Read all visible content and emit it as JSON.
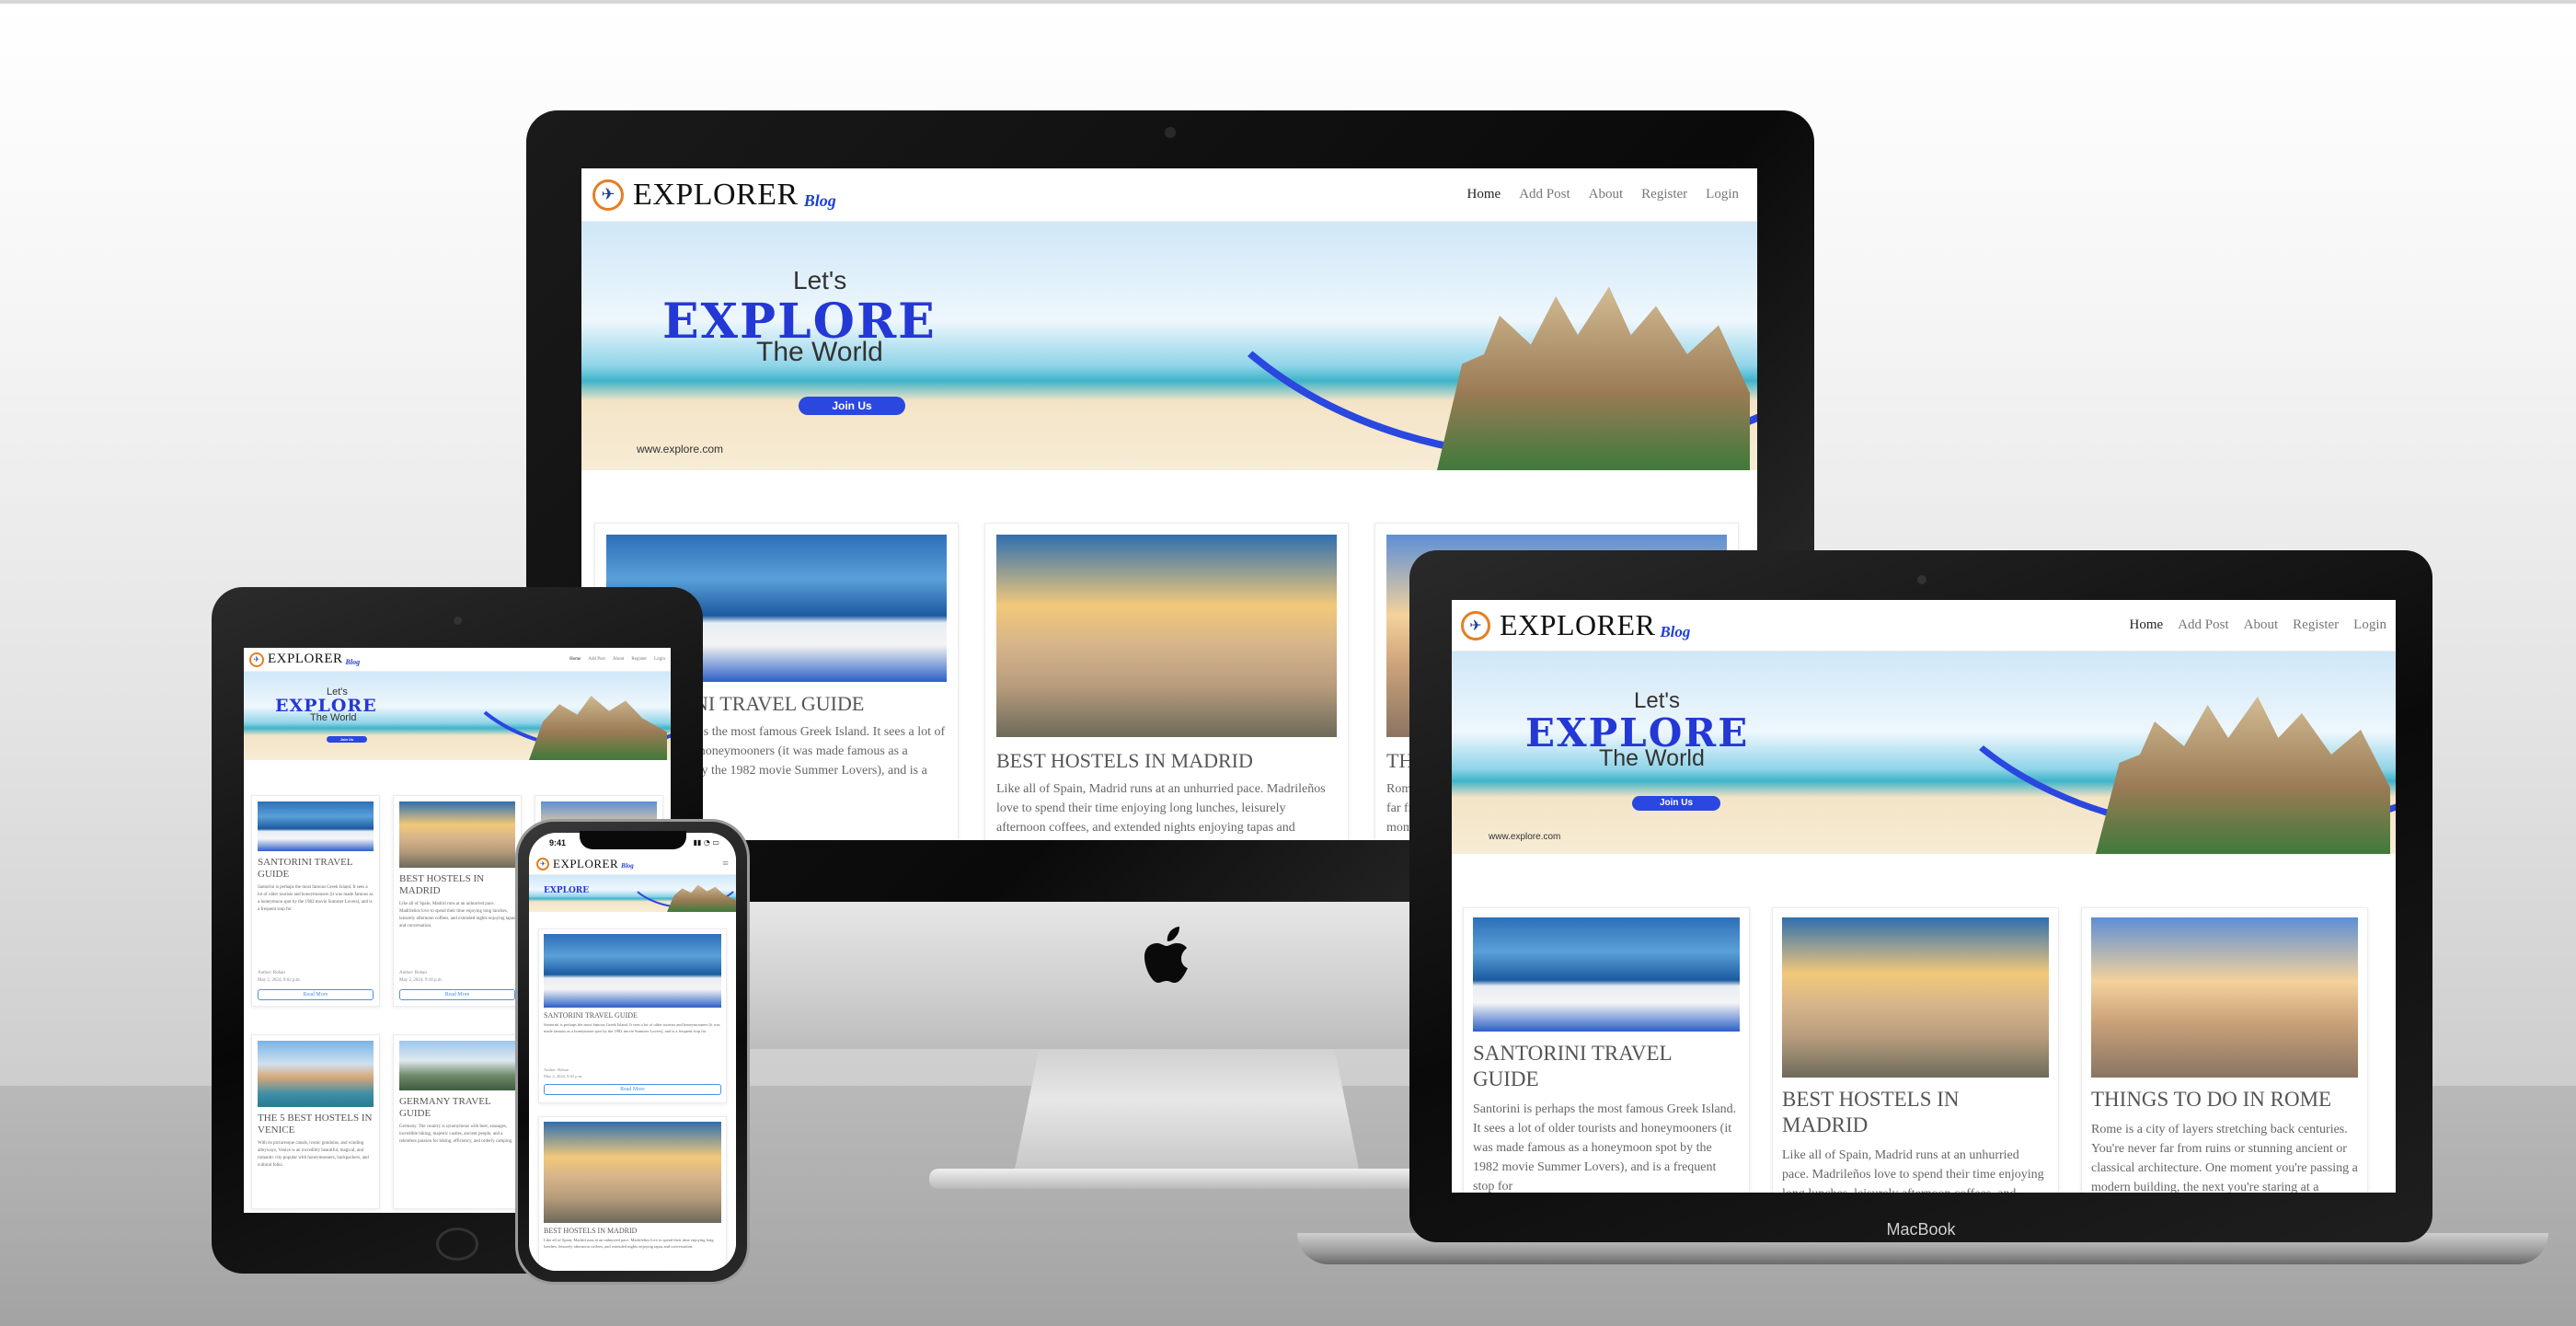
{
  "site": {
    "brand_name": "EXPLORER",
    "brand_sub": "Blog",
    "nav": [
      "Home",
      "Add Post",
      "About",
      "Register",
      "Login"
    ],
    "banner": {
      "lets": "Let's",
      "explore": "EXPLORE",
      "world": "The World",
      "join": "Join Us",
      "url": "www.explore.com"
    }
  },
  "posts": [
    {
      "title": "SANTORINI TRAVEL GUIDE",
      "excerpt": "Santorini is perhaps the most famous Greek Island. It sees a lot of older tourists and honeymooners (it was made famous as a honeymoon spot by the 1982 movie Summer Lovers), and is a frequent stop for",
      "author": "Author: Rohan",
      "date": "May 2, 2024, 9:02 p.m."
    },
    {
      "title": "BEST HOSTELS IN MADRID",
      "excerpt": "Like all of Spain, Madrid runs at an unhurried pace. Madrileños love to spend their time enjoying long lunches, leisurely afternoon coffees, and extended nights enjoying tapas and conversation.",
      "author": "Author: Rohan",
      "date": "May 2, 2024, 9:18 p.m."
    },
    {
      "title": "THINGS TO DO IN ROME",
      "excerpt": "Rome is a city of layers stretching back centuries. You're never far from ruins or stunning ancient or classical architecture. One moment you're passing a modern building, the next you're staring at a"
    },
    {
      "title": "THE 5 BEST HOSTELS IN VENICE",
      "excerpt": "With its picturesque canals, iconic gondolas, and winding alleyways, Venice is an incredibly beautiful, magical, and romantic city popular with honeymooners, backpackers, and cultural folks."
    },
    {
      "title": "GERMANY TRAVEL GUIDE",
      "excerpt": "Germany. The country is synonymous with beer, sausages, incredible hiking, majestic castles, ancient people, and a relentless passion for biking, efficiency, and orderly camping."
    }
  ],
  "read_more": "Read More",
  "phone": {
    "time": "9:41"
  },
  "macbook_label": "MacBook",
  "colors": {
    "brand_accent": "#1f3fd6",
    "logo_ring": "#e67e22",
    "read_more": "#4a90e2"
  }
}
